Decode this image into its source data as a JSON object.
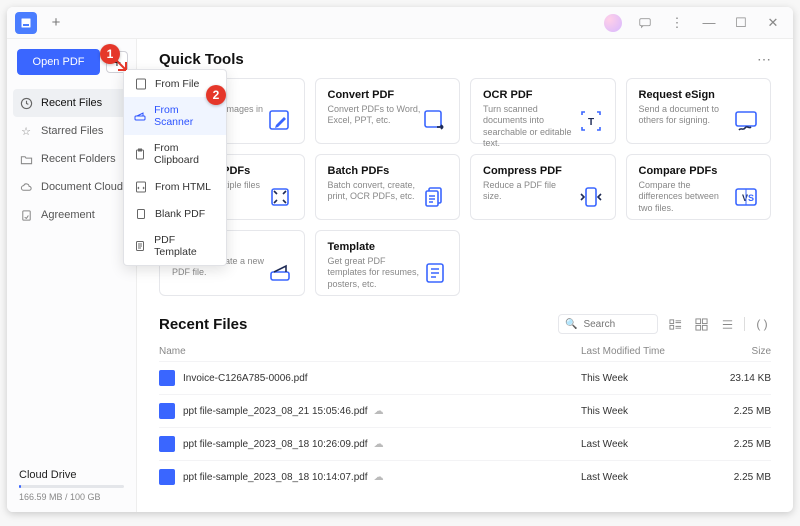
{
  "titlebar": {
    "plus_tooltip": "+"
  },
  "sidebar": {
    "open_label": "Open PDF",
    "plus_tooltip": "+",
    "items": [
      {
        "label": "Recent Files"
      },
      {
        "label": "Starred Files"
      },
      {
        "label": "Recent Folders"
      },
      {
        "label": "Document Cloud"
      },
      {
        "label": "Agreement"
      }
    ],
    "cloud_title": "Cloud Drive",
    "cloud_usage": "166.59 MB / 100 GB"
  },
  "plus_menu": [
    {
      "label": "From File"
    },
    {
      "label": "From Scanner"
    },
    {
      "label": "From Clipboard"
    },
    {
      "label": "From HTML"
    },
    {
      "label": "Blank PDF"
    },
    {
      "label": "PDF Template"
    }
  ],
  "quick_tools": {
    "title": "Quick Tools",
    "tools": [
      {
        "name": "Edit PDF",
        "desc": "Edit text and images in a PDF."
      },
      {
        "name": "Convert PDF",
        "desc": "Convert PDFs to Word, Excel, PPT, etc."
      },
      {
        "name": "OCR PDF",
        "desc": "Turn scanned documents into searchable or editable text."
      },
      {
        "name": "Request eSign",
        "desc": "Send a document to others for signing."
      },
      {
        "name": "Combine PDFs",
        "desc": "Combine multiple files into one PDF."
      },
      {
        "name": "Batch PDFs",
        "desc": "Batch convert, create, print, OCR PDFs, etc."
      },
      {
        "name": "Compress PDF",
        "desc": "Reduce a PDF file size."
      },
      {
        "name": "Compare PDFs",
        "desc": "Compare the differences between two files."
      },
      {
        "name": "Scan",
        "desc": "Scan and create a new PDF file."
      },
      {
        "name": "Template",
        "desc": "Get great PDF templates for resumes, posters, etc."
      }
    ]
  },
  "recent": {
    "title": "Recent Files",
    "search_placeholder": "Search",
    "columns": {
      "name": "Name",
      "time": "Last Modified Time",
      "size": "Size"
    },
    "rows": [
      {
        "name": "Invoice-C126A785-0006.pdf",
        "time": "This Week",
        "size": "23.14 KB",
        "cloud": false
      },
      {
        "name": "ppt file-sample_2023_08_21 15:05:46.pdf",
        "time": "This Week",
        "size": "2.25 MB",
        "cloud": true
      },
      {
        "name": "ppt file-sample_2023_08_18 10:26:09.pdf",
        "time": "Last Week",
        "size": "2.25 MB",
        "cloud": true
      },
      {
        "name": "ppt file-sample_2023_08_18 10:14:07.pdf",
        "time": "Last Week",
        "size": "2.25 MB",
        "cloud": true
      }
    ]
  },
  "annotations": {
    "a1": "1",
    "a2": "2"
  }
}
